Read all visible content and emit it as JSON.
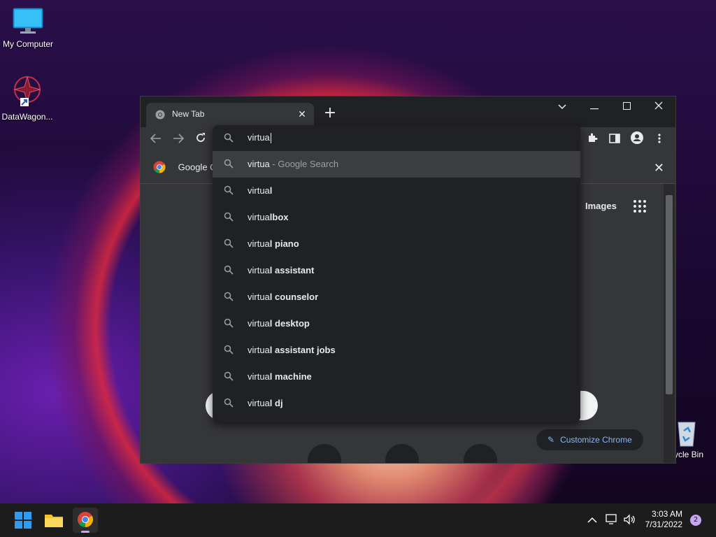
{
  "desktop": {
    "icons": [
      {
        "label": "My Computer"
      },
      {
        "label": "DataWagon..."
      },
      {
        "label": "cycle Bin"
      }
    ]
  },
  "browser": {
    "tab": {
      "title": "New Tab",
      "close_glyph": "✕"
    },
    "new_tab_glyph": "+",
    "bookmark": {
      "label": "Google C"
    },
    "omnibox": {
      "query": "virtua",
      "suggestions": [
        {
          "bold_prefix": "virtua",
          "rest": "",
          "desc": " - Google Search",
          "selected": true
        },
        {
          "bold_prefix": "virtua",
          "rest": "l",
          "desc": ""
        },
        {
          "bold_prefix": "virtua",
          "rest": "lbox",
          "desc": ""
        },
        {
          "bold_prefix": "virtua",
          "rest": "l piano",
          "desc": ""
        },
        {
          "bold_prefix": "virtua",
          "rest": "l assistant",
          "desc": ""
        },
        {
          "bold_prefix": "virtua",
          "rest": "l counselor",
          "desc": ""
        },
        {
          "bold_prefix": "virtua",
          "rest": "l desktop",
          "desc": ""
        },
        {
          "bold_prefix": "virtua",
          "rest": "l assistant jobs",
          "desc": ""
        },
        {
          "bold_prefix": "virtua",
          "rest": "l machine",
          "desc": ""
        },
        {
          "bold_prefix": "virtua",
          "rest": "l dj",
          "desc": ""
        }
      ]
    },
    "newtab_page": {
      "images_link": "Images",
      "customize_label": "Customize Chrome"
    }
  },
  "taskbar": {
    "time": "3:03 AM",
    "date": "7/31/2022",
    "notification_count": "2"
  },
  "colors": {
    "accent_blue": "#8ab4f8",
    "chrome_dark": "#202124",
    "chrome_toolbar": "#35363a"
  }
}
